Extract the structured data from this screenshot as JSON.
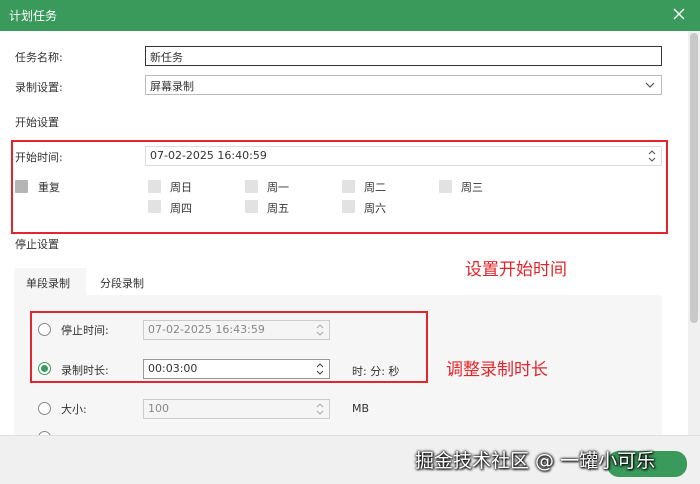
{
  "window": {
    "title": "计划任务"
  },
  "task_name": {
    "label": "任务名称:",
    "value": "新任务"
  },
  "record_settings": {
    "label": "录制设置:",
    "value": "屏幕录制"
  },
  "start_section": {
    "heading": "开始设置",
    "start_time_label": "开始时间:",
    "start_time_value": "07-02-2025 16:40:59",
    "repeat_label": "重复",
    "days": [
      "周日",
      "周一",
      "周二",
      "周三",
      "周四",
      "周五",
      "周六"
    ]
  },
  "stop_section": {
    "heading": "停止设置",
    "tabs": [
      "单段录制",
      "分段录制"
    ],
    "stop_time_label": "停止时间:",
    "stop_time_value": "07-02-2025 16:43:59",
    "duration_label": "录制时长:",
    "duration_value": "00:03:00",
    "duration_unit": "时: 分: 秒",
    "size_label": "大小:",
    "size_value": "100",
    "size_unit": "MB"
  },
  "annotations": {
    "start_note": "设置开始时间",
    "duration_note": "调整录制时长"
  },
  "watermark": "掘金技术社区 @ 一罐小可乐",
  "colors": {
    "title_bar": "#3a9a5c",
    "highlight": "#e3262c"
  }
}
